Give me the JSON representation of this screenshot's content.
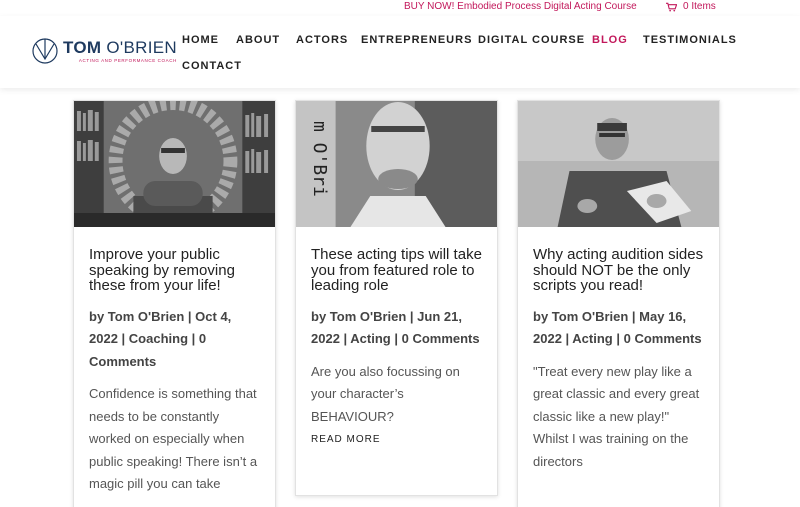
{
  "topbar": {
    "promo": "BUY NOW! Embodied Process Digital Acting Course",
    "cart": "0 Items",
    "cart_icon": "cart-icon"
  },
  "brand": {
    "first": "TOM",
    "last": "O'BRIEN",
    "tagline": "ACTING AND PERFORMANCE COACH",
    "colors": {
      "navy": "#1e3a5f",
      "accent": "#c2185b"
    }
  },
  "nav": {
    "items": [
      {
        "label": "HOME",
        "active": false
      },
      {
        "label": "ABOUT",
        "active": false
      },
      {
        "label": "ACTORS",
        "active": false
      },
      {
        "label": "ENTREPRENEURS",
        "active": false
      },
      {
        "label": "DIGITAL COURSE",
        "active": false
      },
      {
        "label": "BLOG",
        "active": true
      },
      {
        "label": "TESTIMONIALS",
        "active": false
      },
      {
        "label": "CONTACT",
        "active": false
      }
    ]
  },
  "posts": [
    {
      "title": "Improve your public speaking by removing these from your life!",
      "meta": "by Tom O'Brien | Oct 4, 2022 | Coaching | 0 Comments",
      "excerpt": "Confidence is something that needs to be constantly worked on especially when public speaking! There isn’t a magic pill you can take"
    },
    {
      "title": "These acting tips will take you from featured role to leading role",
      "meta": "by Tom O'Brien | Jun 21, 2022 | Acting | 0 Comments",
      "excerpt": "Are you also focussing on your character’s BEHAVIOUR?",
      "more": "READ MORE"
    },
    {
      "title": "Why acting audition sides should NOT be the only scripts you read!",
      "meta": "by Tom O'Brien | May 16, 2022 | Acting | 0 Comments",
      "excerpt": " \"Treat every new play like a great classic and every great classic like a new play!\"   Whilst I was training on the directors"
    }
  ]
}
